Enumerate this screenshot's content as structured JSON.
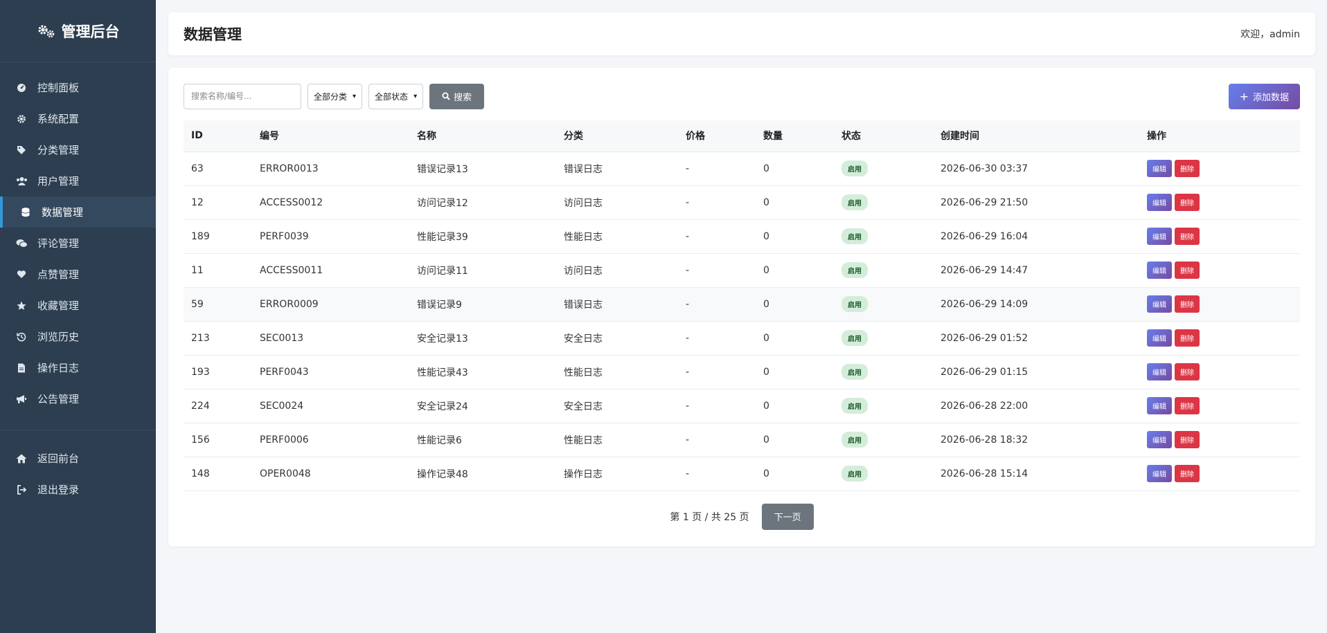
{
  "sidebar": {
    "brand": "管理后台",
    "items": [
      {
        "label": "控制面板",
        "icon": "dashboard-icon"
      },
      {
        "label": "系统配置",
        "icon": "gear-icon"
      },
      {
        "label": "分类管理",
        "icon": "tags-icon"
      },
      {
        "label": "用户管理",
        "icon": "users-icon"
      },
      {
        "label": "数据管理",
        "icon": "database-icon",
        "active": true
      },
      {
        "label": "评论管理",
        "icon": "comments-icon"
      },
      {
        "label": "点赞管理",
        "icon": "heart-icon"
      },
      {
        "label": "收藏管理",
        "icon": "star-icon"
      },
      {
        "label": "浏览历史",
        "icon": "history-icon"
      },
      {
        "label": "操作日志",
        "icon": "file-icon"
      },
      {
        "label": "公告管理",
        "icon": "bullhorn-icon"
      }
    ],
    "bottom_items": [
      {
        "label": "返回前台",
        "icon": "home-icon"
      },
      {
        "label": "退出登录",
        "icon": "sign-out-icon"
      }
    ]
  },
  "header": {
    "title": "数据管理",
    "welcome": "欢迎，admin"
  },
  "toolbar": {
    "search_placeholder": "搜索名称/编号...",
    "category_select": "全部分类",
    "status_select": "全部状态",
    "search_label": "搜索",
    "add_label": "添加数据"
  },
  "table": {
    "columns": [
      "ID",
      "编号",
      "名称",
      "分类",
      "价格",
      "数量",
      "状态",
      "创建时间",
      "操作"
    ],
    "rows": [
      {
        "id": "63",
        "code": "ERROR0013",
        "name": "错误记录13",
        "category": "错误日志",
        "price": "-",
        "qty": "0",
        "status": "启用",
        "created": "2026-06-30 03:37"
      },
      {
        "id": "12",
        "code": "ACCESS0012",
        "name": "访问记录12",
        "category": "访问日志",
        "price": "-",
        "qty": "0",
        "status": "启用",
        "created": "2026-06-29 21:50"
      },
      {
        "id": "189",
        "code": "PERF0039",
        "name": "性能记录39",
        "category": "性能日志",
        "price": "-",
        "qty": "0",
        "status": "启用",
        "created": "2026-06-29 16:04"
      },
      {
        "id": "11",
        "code": "ACCESS0011",
        "name": "访问记录11",
        "category": "访问日志",
        "price": "-",
        "qty": "0",
        "status": "启用",
        "created": "2026-06-29 14:47"
      },
      {
        "id": "59",
        "code": "ERROR0009",
        "name": "错误记录9",
        "category": "错误日志",
        "price": "-",
        "qty": "0",
        "status": "启用",
        "created": "2026-06-29 14:09"
      },
      {
        "id": "213",
        "code": "SEC0013",
        "name": "安全记录13",
        "category": "安全日志",
        "price": "-",
        "qty": "0",
        "status": "启用",
        "created": "2026-06-29 01:52"
      },
      {
        "id": "193",
        "code": "PERF0043",
        "name": "性能记录43",
        "category": "性能日志",
        "price": "-",
        "qty": "0",
        "status": "启用",
        "created": "2026-06-29 01:15"
      },
      {
        "id": "224",
        "code": "SEC0024",
        "name": "安全记录24",
        "category": "安全日志",
        "price": "-",
        "qty": "0",
        "status": "启用",
        "created": "2026-06-28 22:00"
      },
      {
        "id": "156",
        "code": "PERF0006",
        "name": "性能记录6",
        "category": "性能日志",
        "price": "-",
        "qty": "0",
        "status": "启用",
        "created": "2026-06-28 18:32"
      },
      {
        "id": "148",
        "code": "OPER0048",
        "name": "操作记录48",
        "category": "操作日志",
        "price": "-",
        "qty": "0",
        "status": "启用",
        "created": "2026-06-28 15:14"
      }
    ],
    "edit_label": "编辑",
    "delete_label": "删除"
  },
  "pagination": {
    "info": "第 1 页 / 共 25 页",
    "next_label": "下一页"
  }
}
